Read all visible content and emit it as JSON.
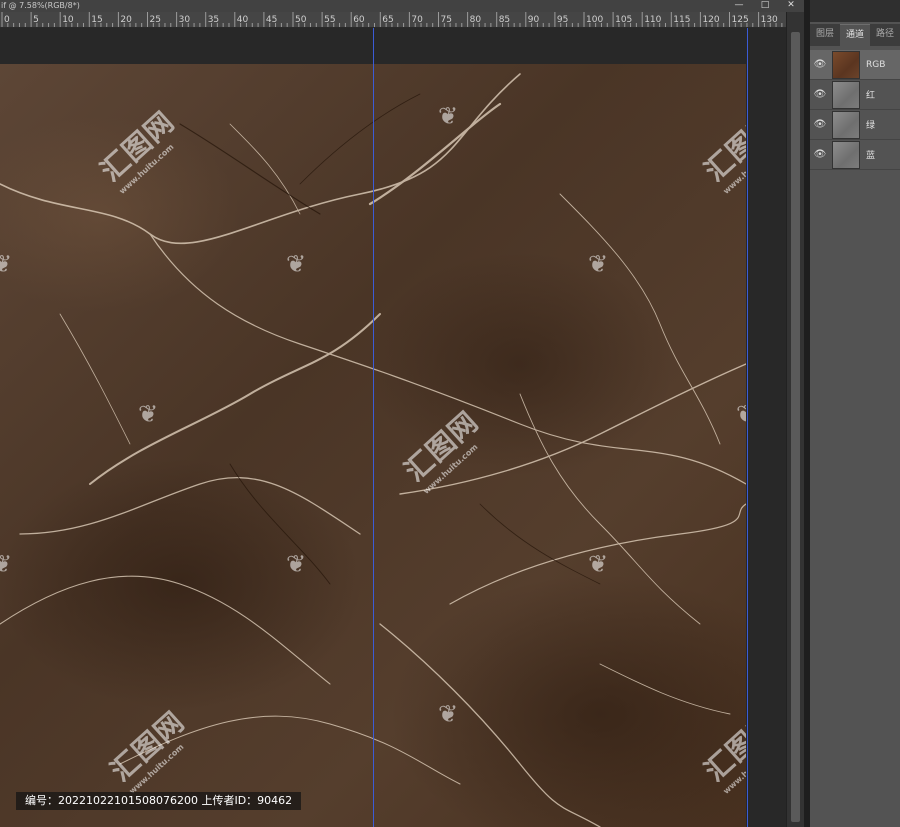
{
  "document": {
    "tab_title": "if @ 7.58%(RGB/8*)",
    "window_buttons": [
      "—",
      "□",
      "✕"
    ]
  },
  "ruler": {
    "labels": [
      "0",
      "5",
      "10",
      "15",
      "20",
      "25",
      "30",
      "35",
      "40",
      "45",
      "50",
      "55",
      "60",
      "65",
      "70",
      "75",
      "80",
      "85",
      "90",
      "95",
      "100",
      "105",
      "110",
      "115",
      "120",
      "125",
      "130",
      "13"
    ]
  },
  "panel": {
    "tabs": [
      "图层",
      "通道",
      "路径"
    ],
    "active_tab": "通道",
    "channels": [
      {
        "name": "RGB",
        "thumb": "rgb"
      },
      {
        "name": "红",
        "thumb": "gray"
      },
      {
        "name": "绿",
        "thumb": "gray"
      },
      {
        "name": "蓝",
        "thumb": "gray"
      }
    ],
    "eye_icon": "eye-icon"
  },
  "watermark": {
    "brand": "汇图网",
    "url": "www.huitu.com",
    "mini": "❦"
  },
  "infobar": {
    "text": "编号：20221022101508076200 上传者ID：90462"
  },
  "colors": {
    "guide": "#3b5bd6",
    "marble_base": "#4f3a2a",
    "vein": "#e8d8c4"
  }
}
